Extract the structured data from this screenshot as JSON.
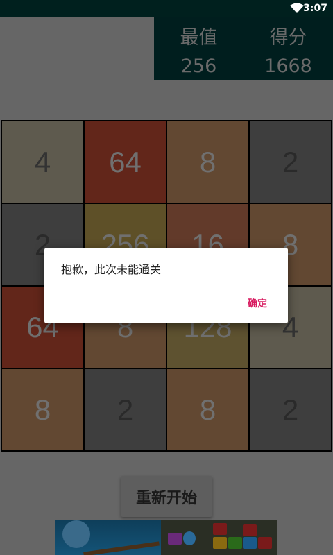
{
  "status_bar": {
    "time": "3:07",
    "wifi_icon": "wifi-icon"
  },
  "score_panel": {
    "best_label": "最值",
    "best_value": "256",
    "score_label": "得分",
    "score_value": "1668"
  },
  "board": {
    "tiles": [
      {
        "value": "4",
        "bg": "#5e5a4e",
        "fg": "#333333"
      },
      {
        "value": "64",
        "bg": "#62261a",
        "fg": "#707070"
      },
      {
        "value": "8",
        "bg": "#624832",
        "fg": "#707070"
      },
      {
        "value": "2",
        "bg": "#3e3e3e",
        "fg": "#2a2a2a"
      },
      {
        "value": "2",
        "bg": "#3e3e3e",
        "fg": "#2a2a2a"
      },
      {
        "value": "256",
        "bg": "#5e5028",
        "fg": "#707070"
      },
      {
        "value": "16",
        "bg": "#623a2a",
        "fg": "#707070"
      },
      {
        "value": "8",
        "bg": "#624832",
        "fg": "#707070"
      },
      {
        "value": "64",
        "bg": "#62261a",
        "fg": "#707070"
      },
      {
        "value": "8",
        "bg": "#624832",
        "fg": "#707070"
      },
      {
        "value": "128",
        "bg": "#5e5230",
        "fg": "#707070"
      },
      {
        "value": "4",
        "bg": "#5e5a4e",
        "fg": "#333333"
      },
      {
        "value": "8",
        "bg": "#624832",
        "fg": "#707070"
      },
      {
        "value": "2",
        "bg": "#3e3e3e",
        "fg": "#2a2a2a"
      },
      {
        "value": "8",
        "bg": "#624832",
        "fg": "#707070"
      },
      {
        "value": "2",
        "bg": "#3e3e3e",
        "fg": "#2a2a2a"
      }
    ]
  },
  "dialog": {
    "message": "抱歉，此次未能通关",
    "ok_label": "确定",
    "accent": "#d81b60"
  },
  "restart_label": "重新开始"
}
